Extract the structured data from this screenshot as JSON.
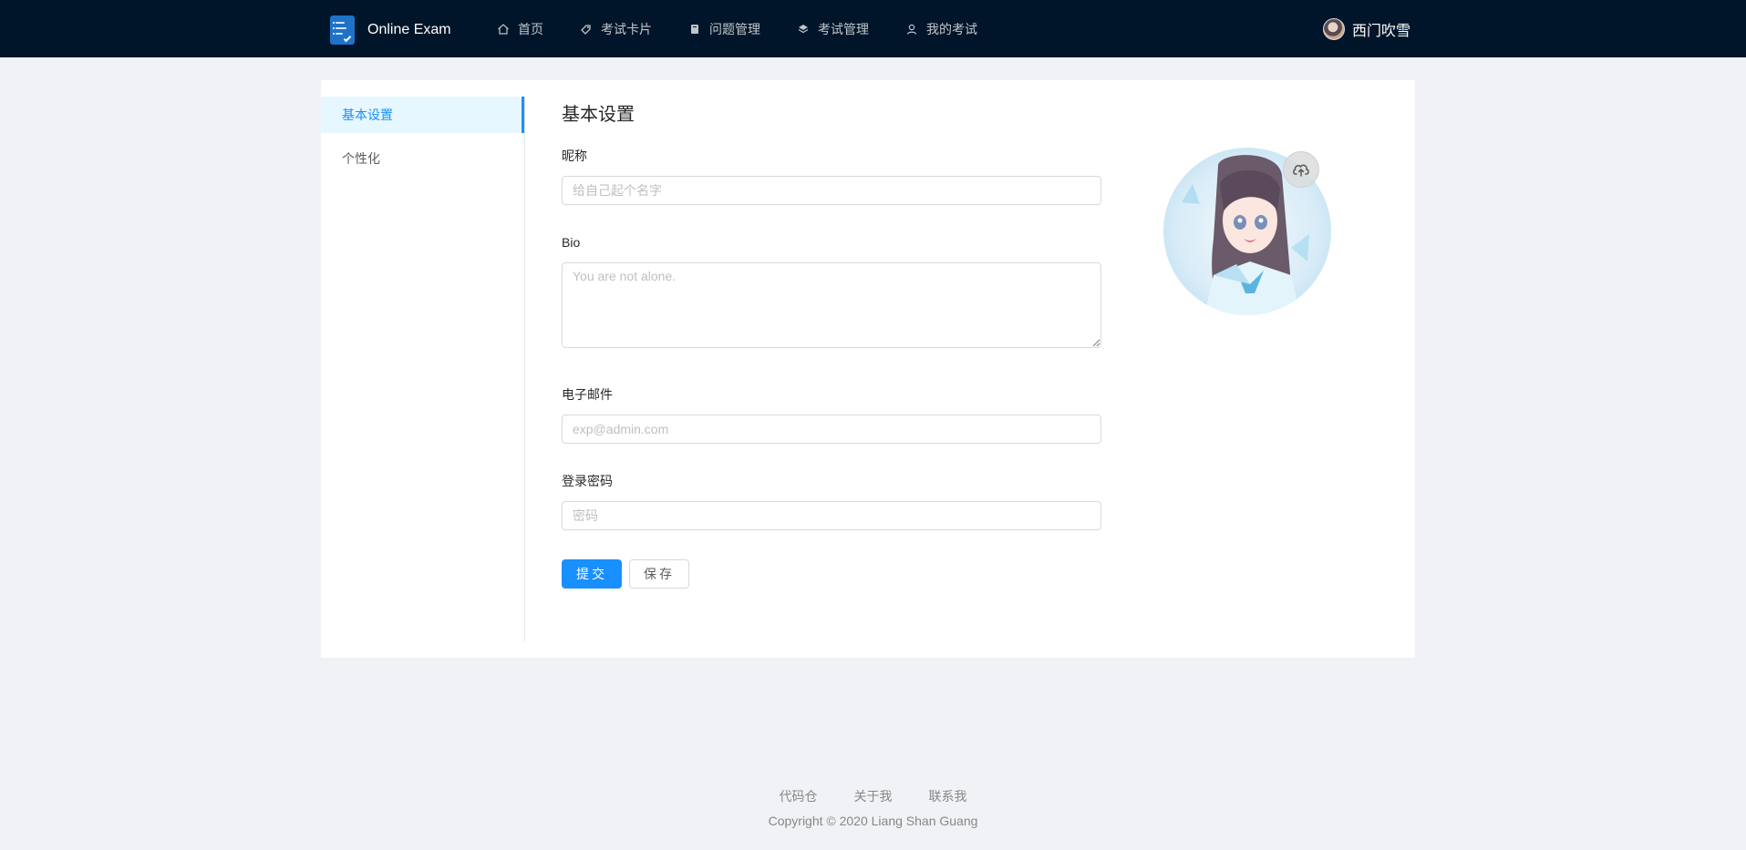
{
  "brand": {
    "name": "Online Exam"
  },
  "nav": {
    "items": [
      {
        "label": "首页",
        "icon": "home-icon"
      },
      {
        "label": "考试卡片",
        "icon": "tag-icon"
      },
      {
        "label": "问题管理",
        "icon": "book-icon"
      },
      {
        "label": "考试管理",
        "icon": "layers-icon"
      },
      {
        "label": "我的考试",
        "icon": "user-icon"
      }
    ]
  },
  "user": {
    "name": "西门吹雪"
  },
  "side_menu": {
    "items": [
      {
        "label": "基本设置",
        "active": true
      },
      {
        "label": "个性化",
        "active": false
      }
    ]
  },
  "form": {
    "title": "基本设置",
    "nickname": {
      "label": "昵称",
      "placeholder": "给自己起个名字",
      "value": ""
    },
    "bio": {
      "label": "Bio",
      "placeholder": "You are not alone.",
      "value": ""
    },
    "email": {
      "label": "电子邮件",
      "placeholder": "exp@admin.com",
      "value": ""
    },
    "password": {
      "label": "登录密码",
      "placeholder": "密码",
      "value": ""
    },
    "submit_label": "提交",
    "save_label": "保存"
  },
  "footer": {
    "links": [
      "代码仓",
      "关于我",
      "联系我"
    ],
    "copyright": "Copyright © 2020 Liang Shan Guang"
  },
  "colors": {
    "header_bg": "#001529",
    "accent": "#1890ff",
    "page_bg": "#f0f2f5"
  }
}
